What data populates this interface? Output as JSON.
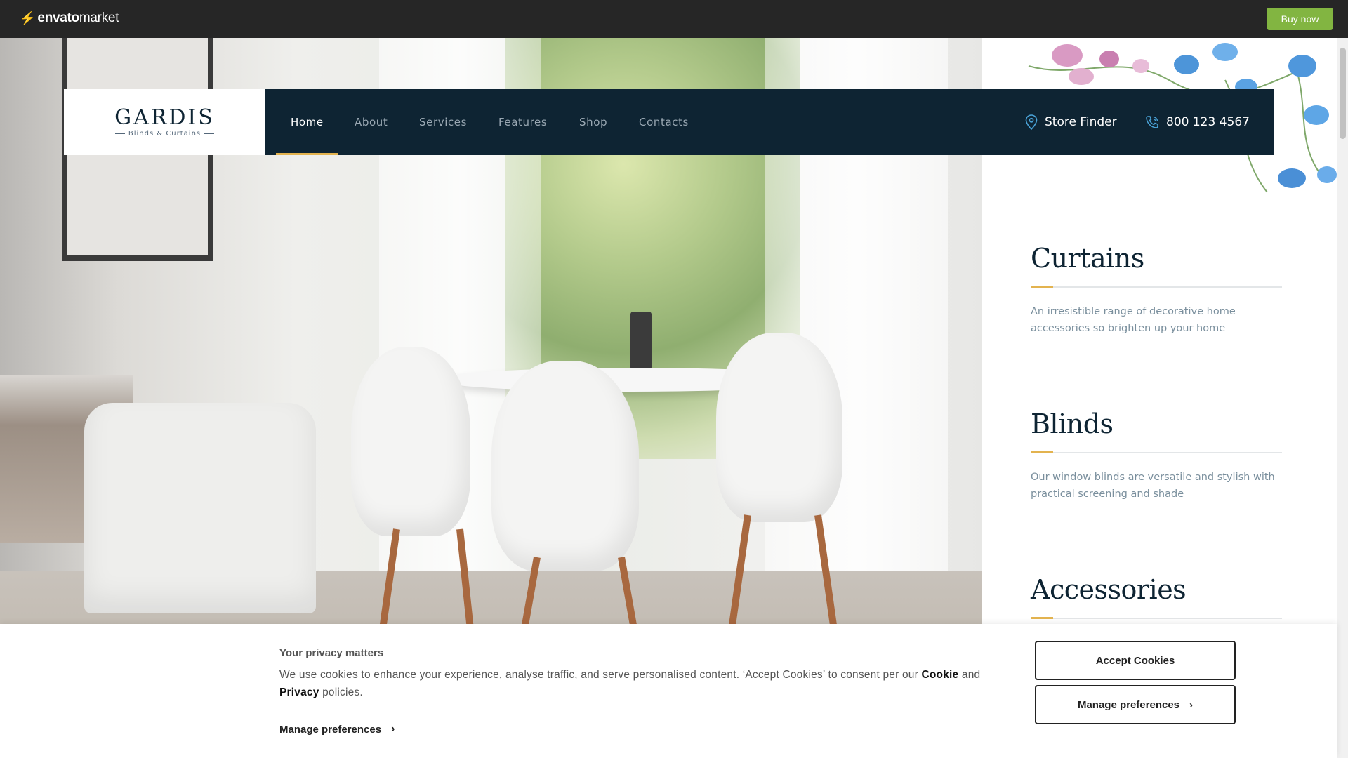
{
  "envato": {
    "brand": "envato",
    "market": "market",
    "buy_now": "Buy now"
  },
  "logo": {
    "name": "GARDIS",
    "tagline": "Blinds & Curtains"
  },
  "nav": {
    "items": [
      {
        "label": "Home",
        "active": true
      },
      {
        "label": "About"
      },
      {
        "label": "Services"
      },
      {
        "label": "Features"
      },
      {
        "label": "Shop"
      },
      {
        "label": "Contacts"
      }
    ],
    "store_finder": "Store Finder",
    "phone": "800 123 4567"
  },
  "sections": [
    {
      "title": "Curtains",
      "text": "An irresistible range of decorative home accessories so brighten up your home"
    },
    {
      "title": "Blinds",
      "text": "Our window blinds are versatile and stylish with practical screening and shade"
    },
    {
      "title": "Accessories",
      "text": ""
    }
  ],
  "cookie": {
    "title": "Your privacy matters",
    "text_before": "We use cookies to enhance your experience, analyse traffic, and serve personalised content. ‘Accept Cookies’ to consent per our",
    "cookie_word": "Cookie",
    "and_word": "and",
    "privacy_word": "Privacy",
    "policies_word": "policies.",
    "manage_link": "Manage preferences",
    "accept_button": "Accept Cookies",
    "manage_button": "Manage preferences"
  },
  "colors": {
    "envato_green": "#82b541",
    "navy": "#0e2433",
    "accent_gold": "#e3b34f"
  }
}
